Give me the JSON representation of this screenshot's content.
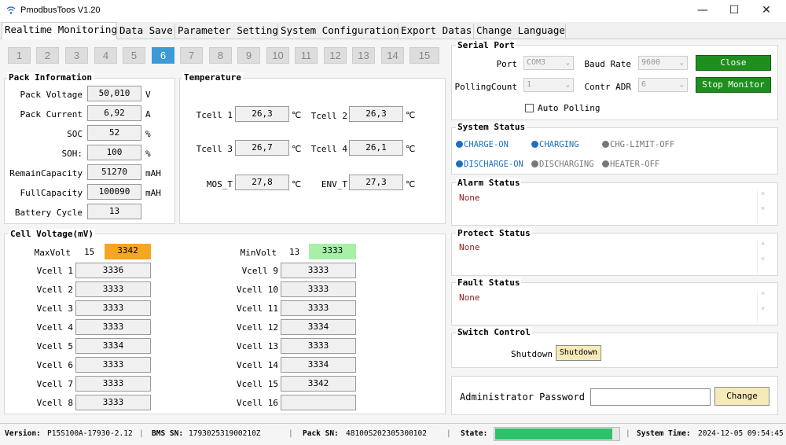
{
  "window": {
    "title": "PmodbusToos V1.20",
    "minimize": "—",
    "maximize": "☐",
    "close": "✕",
    "icon": "wifi-icon"
  },
  "tabs": [
    "Realtime Monitoring",
    "Data Save",
    "Parameter Setting",
    "System Configuration",
    "Export Datas",
    "Change Language"
  ],
  "pages": {
    "buttons": [
      "1",
      "2",
      "3",
      "4",
      "5",
      "6",
      "7",
      "8",
      "9",
      "10",
      "11",
      "12",
      "13",
      "14",
      "15"
    ],
    "active": "6"
  },
  "pack": {
    "title": "Pack Information",
    "fields": [
      {
        "label": "Pack Voltage",
        "value": "50,010",
        "unit": "V"
      },
      {
        "label": "Pack Current",
        "value": "6,92",
        "unit": "A"
      },
      {
        "label": "SOC",
        "value": "52",
        "unit": "%"
      },
      {
        "label": "SOH:",
        "value": "100",
        "unit": "%"
      },
      {
        "label": "RemainCapacity",
        "value": "51270",
        "unit": "mAH"
      },
      {
        "label": "FullCapacity",
        "value": "100090",
        "unit": "mAH"
      },
      {
        "label": "Battery Cycle",
        "value": "13",
        "unit": ""
      }
    ]
  },
  "temperature": {
    "title": "Temperature",
    "unit": "℃",
    "items": [
      {
        "label": "Tcell 1",
        "value": "26,3"
      },
      {
        "label": "Tcell 2",
        "value": "26,3"
      },
      {
        "label": "Tcell 3",
        "value": "26,7"
      },
      {
        "label": "Tcell 4",
        "value": "26,1"
      },
      {
        "label": "MOS_T",
        "value": "27,8"
      },
      {
        "label": "ENV_T",
        "value": "27,3"
      }
    ]
  },
  "cells": {
    "title": "Cell Voltage(mV)",
    "max": {
      "label": "MaxVolt",
      "index": "15",
      "value": "3342",
      "color": "#f5a623"
    },
    "min": {
      "label": "MinVolt",
      "index": "13",
      "value": "3333",
      "color": "#a8f0a8"
    },
    "items": [
      {
        "label": "Vcell 1",
        "value": "3336"
      },
      {
        "label": "Vcell 2",
        "value": "3333"
      },
      {
        "label": "Vcell 3",
        "value": "3333"
      },
      {
        "label": "Vcell 4",
        "value": "3333"
      },
      {
        "label": "Vcell 5",
        "value": "3334"
      },
      {
        "label": "Vcell 6",
        "value": "3333"
      },
      {
        "label": "Vcell 7",
        "value": "3333"
      },
      {
        "label": "Vcell 8",
        "value": "3333"
      },
      {
        "label": "Vcell 9",
        "value": "3333"
      },
      {
        "label": "Vcell 10",
        "value": "3333"
      },
      {
        "label": "Vcell 11",
        "value": "3333"
      },
      {
        "label": "Vcell 12",
        "value": "3334"
      },
      {
        "label": "Vcell 13",
        "value": "3333"
      },
      {
        "label": "Vcell 14",
        "value": "3334"
      },
      {
        "label": "Vcell 15",
        "value": "3342"
      },
      {
        "label": "Vcell 16",
        "value": ""
      }
    ]
  },
  "serial": {
    "title": "Serial Port",
    "port_label": "Port",
    "port": "COM3",
    "baud_label": "Baud Rate",
    "baud": "9600",
    "close": "Close",
    "polling_label": "PollingCount",
    "polling": "1",
    "adr_label": "Contr ADR",
    "adr": "6",
    "stop": "Stop Monitor",
    "auto": "Auto Polling"
  },
  "system_status": {
    "title": "System Status",
    "items": [
      {
        "label": "CHARGE-ON",
        "color": "#1f6fbf"
      },
      {
        "label": "CHARGING",
        "color": "#1f6fbf"
      },
      {
        "label": "CHG-LIMIT-OFF",
        "color": "#777777"
      },
      {
        "label": "DISCHARGE-ON",
        "color": "#1f6fbf"
      },
      {
        "label": "DISCHARGING",
        "color": "#777777"
      },
      {
        "label": "HEATER-OFF",
        "color": "#777777"
      }
    ]
  },
  "alarm": {
    "title": "Alarm Status",
    "text": "None"
  },
  "protect": {
    "title": "Protect Status",
    "text": "None"
  },
  "fault": {
    "title": "Fault Status",
    "text": "None"
  },
  "switch": {
    "title": "Switch Control",
    "label": "Shutdown",
    "button": "Shutdown"
  },
  "admin": {
    "label": "Administrator Password",
    "button": "Change"
  },
  "statusbar": {
    "version_label": "Version:",
    "version": "P15S100A-17930-2.12",
    "bms_label": "BMS SN:",
    "bms": "179302531900210Z",
    "pack_label": "Pack SN:",
    "pack": "48100S202305300102",
    "state_label": "State:",
    "state_progress": 0.95,
    "time_label": "System Time:",
    "time": "2024-12-05 09:54:45"
  }
}
